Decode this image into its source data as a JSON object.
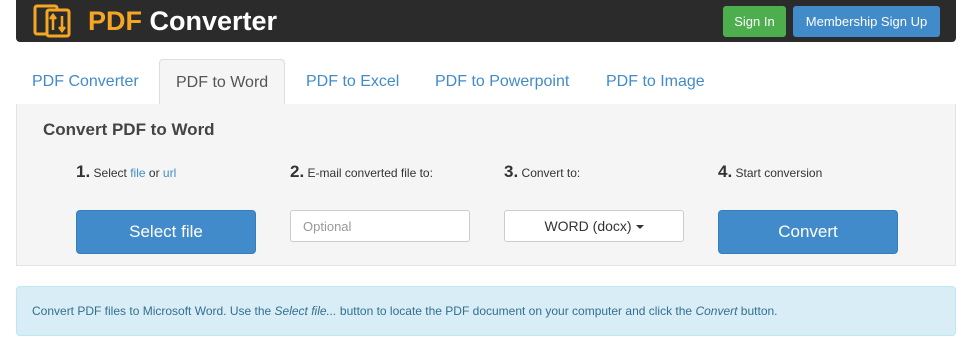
{
  "header": {
    "brand_pdf": "PDF",
    "brand_rest": "Converter",
    "signin_label": "Sign In",
    "membership_label": "Membership Sign Up",
    "logo_icon": "document-arrows-icon"
  },
  "tabs": [
    {
      "label": "PDF Converter",
      "active": false
    },
    {
      "label": "PDF to Word",
      "active": true
    },
    {
      "label": "PDF to Excel",
      "active": false
    },
    {
      "label": "PDF to Powerpoint",
      "active": false
    },
    {
      "label": "PDF to Image",
      "active": false
    }
  ],
  "panel": {
    "title": "Convert PDF to Word",
    "step1": {
      "num": "1.",
      "text_a": "Select ",
      "link_file": "file",
      "text_b": " or ",
      "link_url": "url"
    },
    "step2": {
      "num": "2.",
      "text": "E-mail converted file to:"
    },
    "step3": {
      "num": "3.",
      "text": "Convert to:"
    },
    "step4": {
      "num": "4.",
      "text": "Start conversion"
    },
    "select_file_label": "Select file",
    "email_placeholder": "Optional",
    "format_value": "WORD (docx)",
    "convert_label": "Convert"
  },
  "info": {
    "part1": "Convert PDF files to Microsoft Word. Use the ",
    "em1": "Select file...",
    "part2": " button to locate the PDF document on your computer and click the ",
    "em2": "Convert",
    "part3": " button."
  },
  "colors": {
    "brand_accent": "#f5a623",
    "primary": "#428bca",
    "success": "#4cae4c",
    "info_bg": "#d9edf7",
    "info_text": "#31708f"
  }
}
